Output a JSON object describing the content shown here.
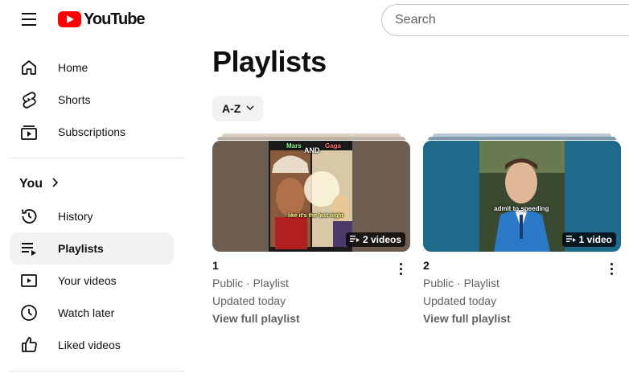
{
  "header": {
    "logo_text": "YouTube",
    "search_placeholder": "Search"
  },
  "sidebar": {
    "main_items": [
      {
        "label": "Home",
        "icon": "home-icon"
      },
      {
        "label": "Shorts",
        "icon": "shorts-icon"
      },
      {
        "label": "Subscriptions",
        "icon": "subscriptions-icon"
      }
    ],
    "you_label": "You",
    "you_items": [
      {
        "label": "History",
        "icon": "history-icon"
      },
      {
        "label": "Playlists",
        "icon": "playlists-icon",
        "active": true
      },
      {
        "label": "Your videos",
        "icon": "your-videos-icon"
      },
      {
        "label": "Watch later",
        "icon": "watch-later-icon"
      },
      {
        "label": "Liked videos",
        "icon": "liked-videos-icon"
      }
    ]
  },
  "main": {
    "title": "Playlists",
    "sort_label": "A-Z",
    "playlists": [
      {
        "title": "1",
        "count_label": "2 videos",
        "visibility": "Public · Playlist",
        "updated": "Updated today",
        "view_label": "View full playlist",
        "thumb_captions": {
          "top_left": "Mars",
          "top_right": "Gaga",
          "center": "AND",
          "bottom": "like it's the last night"
        }
      },
      {
        "title": "2",
        "count_label": "1 video",
        "visibility": "Public · Playlist",
        "updated": "Updated today",
        "view_label": "View full playlist",
        "thumb_captions": {
          "center": "admit to speeding"
        }
      }
    ]
  },
  "colors": {
    "brand_red": "#ff0000",
    "active_bg": "#f2f2f2",
    "secondary_text": "#606060"
  }
}
